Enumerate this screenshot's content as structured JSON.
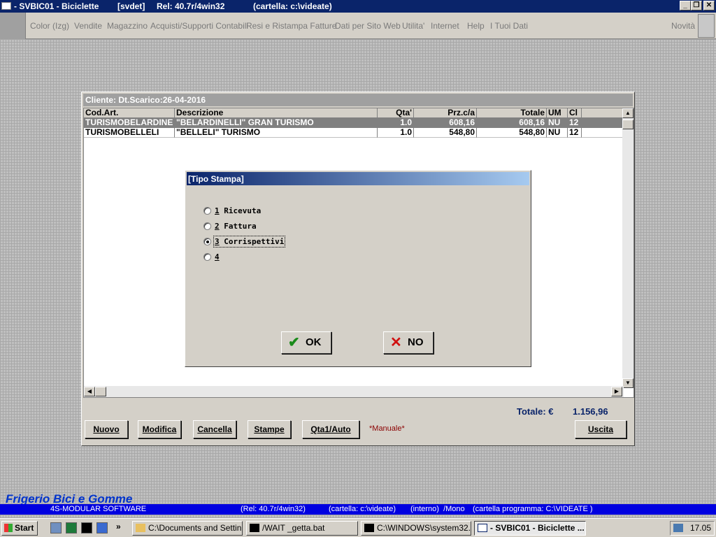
{
  "window": {
    "title": "- SVBIC01 - Biciclette",
    "tag": "[svdet]",
    "release": "Rel: 40.7r/4win32",
    "folder": "(cartella: c:\\videate)"
  },
  "menu": {
    "items": [
      "Color (Izg)",
      "Vendite",
      "Magazzino",
      "Acquisti/Supporti Contabili",
      "Resi e Ristampa Fatture",
      "Dati per Sito Web",
      "Utilita'",
      "Internet",
      "Help",
      "I Tuoi Dati"
    ],
    "novita": "Novità"
  },
  "main": {
    "cliente": "Cliente:  Dt.Scarico:26-04-2016",
    "columns": [
      "Cod.Art.",
      "Descrizione",
      "Qta'",
      "Prz.c/a",
      "Totale",
      "UM",
      "Cl"
    ],
    "rows": [
      [
        "TURISMOBELARDINE",
        "\"BELARDINELLI\" GRAN TURISMO",
        "1.0",
        "608,16",
        "608,16",
        "NU",
        "12"
      ],
      [
        "TURISMOBELLELI",
        "\"BELLELI\" TURISMO",
        "1.0",
        "548,80",
        "548,80",
        "NU",
        "12"
      ]
    ],
    "totale_label": "Totale: €",
    "totale_value": "1.156,96",
    "buttons": {
      "nuovo": "Nuovo",
      "modifica": "Modifica",
      "cancella": "Cancella",
      "stampe": "Stampe",
      "qta": "Qta1/Auto",
      "uscita": "Uscita"
    },
    "manuale": "*Manuale*"
  },
  "dialog": {
    "title": "[Tipo Stampa]",
    "options": [
      {
        "num": "1",
        "label": "Ricevuta"
      },
      {
        "num": "2",
        "label": "Fattura"
      },
      {
        "num": "3",
        "label": "Corrispettivi"
      },
      {
        "num": "4",
        "label": ""
      }
    ],
    "selected_index": 2,
    "ok": "OK",
    "no": "NO"
  },
  "footer": {
    "brand": "Frigerio Bici e Gomme",
    "software": "4S-MODULAR SOFTWARE",
    "release": "(Rel: 40.7r/4win32)",
    "folder": "(cartella: c:\\videate)",
    "mode": "(interno)  /Mono",
    "program_folder": "(cartella programma: C:\\VIDEATE )"
  },
  "taskbar": {
    "start": "Start",
    "tasks": [
      "C:\\Documents and Settin...",
      "/WAIT _getta.bat",
      "C:\\WINDOWS\\system32...",
      "- SVBIC01 - Biciclette ..."
    ],
    "clock": "17.05"
  },
  "colors": {
    "titlebar": "#0a246a",
    "infobar": "#0000e0",
    "brand": "#0033cc",
    "selected_row": "#808080"
  }
}
